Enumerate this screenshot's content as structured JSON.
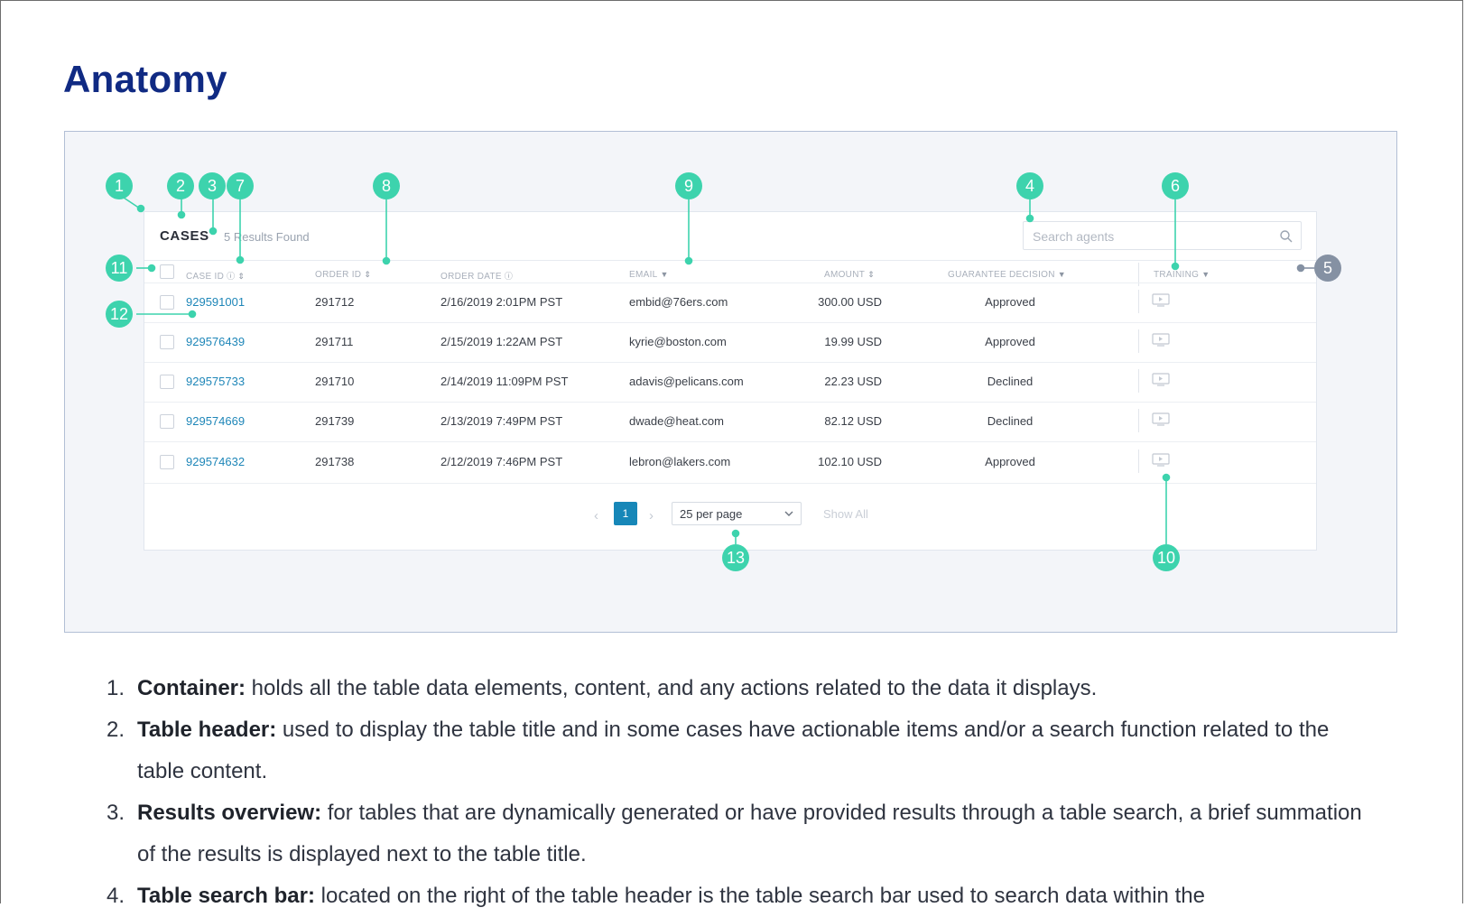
{
  "page": {
    "title": "Anatomy"
  },
  "table": {
    "title": "CASES",
    "results": "5 Results Found",
    "search_placeholder": "Search agents",
    "columns": [
      {
        "label": "CASE ID",
        "marker": "ⓘ ⇕"
      },
      {
        "label": "ORDER ID",
        "marker": "⇕"
      },
      {
        "label": "ORDER DATE",
        "marker": "ⓘ"
      },
      {
        "label": "EMAIL",
        "marker": "▼"
      },
      {
        "label": "AMOUNT",
        "marker": "⇕"
      },
      {
        "label": "GUARANTEE DECISION",
        "marker": "▼"
      },
      {
        "label": "TRAINING",
        "marker": "▼"
      }
    ],
    "rows": [
      {
        "case_id": "929591001",
        "order_id": "291712",
        "order_date": "2/16/2019 2:01PM PST",
        "email": "embid@76ers.com",
        "amount": "300.00  USD",
        "decision": "Approved"
      },
      {
        "case_id": "929576439",
        "order_id": "291711",
        "order_date": "2/15/2019 1:22AM PST",
        "email": "kyrie@boston.com",
        "amount": "19.99  USD",
        "decision": "Approved"
      },
      {
        "case_id": "929575733",
        "order_id": "291710",
        "order_date": "2/14/2019 11:09PM PST",
        "email": "adavis@pelicans.com",
        "amount": "22.23  USD",
        "decision": "Declined"
      },
      {
        "case_id": "929574669",
        "order_id": "291739",
        "order_date": "2/13/2019 7:49PM PST",
        "email": "dwade@heat.com",
        "amount": "82.12  USD",
        "decision": "Declined"
      },
      {
        "case_id": "929574632",
        "order_id": "291738",
        "order_date": "2/12/2019 7:46PM PST",
        "email": "lebron@lakers.com",
        "amount": "102.10  USD",
        "decision": "Approved"
      }
    ],
    "pagination": {
      "prev": "‹",
      "next": "›",
      "current_page": "1",
      "per_page": "25 per page",
      "show_all": "Show All"
    }
  },
  "callouts": [
    "1",
    "2",
    "3",
    "7",
    "8",
    "9",
    "4",
    "6",
    "11",
    "5",
    "12",
    "13",
    "10"
  ],
  "descriptions": [
    {
      "num": "1.",
      "term": "Container:",
      "text": " holds all the table data elements, content, and any actions related to the data it displays."
    },
    {
      "num": "2.",
      "term": "Table header:",
      "text": " used to display the table title and in some cases have actionable items and/or a search function related to the table content."
    },
    {
      "num": "3.",
      "term": "Results overview:",
      "text": " for tables that are dynamically generated or have provided results through a table search, a brief summation of the results is displayed next to the table title."
    },
    {
      "num": "4.",
      "term": "Table search bar:",
      "text": " located on the right of the table header is the table search bar used to search data within the"
    }
  ],
  "colors": {
    "title": "#102a83",
    "callout": "#3dd3ad",
    "callout_grey": "#8591a3",
    "link": "#1e86b8",
    "page_active": "#1787b8"
  }
}
